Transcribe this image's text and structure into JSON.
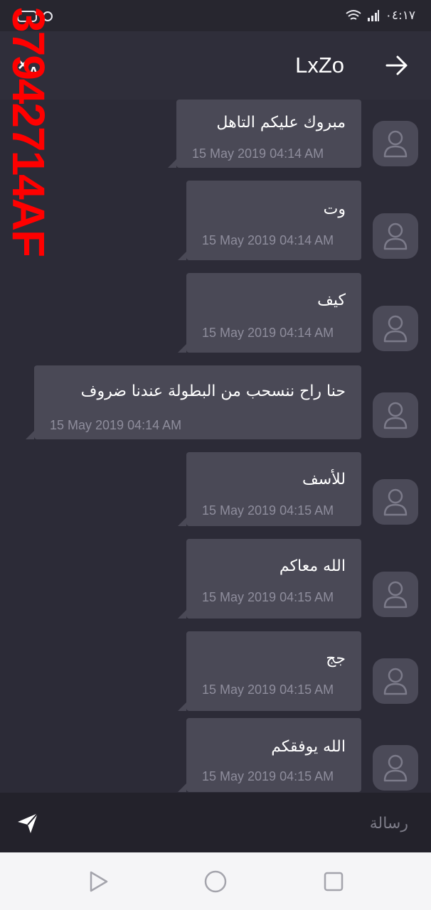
{
  "status_bar": {
    "time": "٠٤:١٧"
  },
  "header": {
    "title": "LxZo"
  },
  "messages": [
    {
      "text": "مبروك عليكم التاهل",
      "time": "15 May 2019 04:14 AM"
    },
    {
      "text": "وت",
      "time": "15 May 2019 04:14 AM"
    },
    {
      "text": "كيف",
      "time": "15 May 2019 04:14 AM"
    },
    {
      "text": "حنا راح ننسحب من البطولة عندنا ضروف",
      "time": "15 May 2019 04:14 AM"
    },
    {
      "text": "للأسف",
      "time": "15 May 2019 04:15 AM"
    },
    {
      "text": "الله معاكم",
      "time": "15 May 2019 04:15 AM"
    },
    {
      "text": "جج",
      "time": "15 May 2019 04:15 AM"
    },
    {
      "text": "الله يوفقكم",
      "time": "15 May 2019 04:15 AM"
    }
  ],
  "composer": {
    "placeholder": "رسالة"
  },
  "watermark": {
    "text": "37942714AF"
  },
  "colors": {
    "background": "#2c2b37",
    "bubble": "#4a4956",
    "accent_watermark": "#ff0000"
  }
}
